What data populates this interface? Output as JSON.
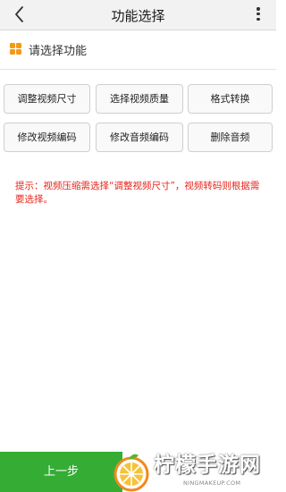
{
  "header": {
    "title": "功能选择",
    "back_icon": "chevron-left-icon",
    "menu_icon": "more-vertical-icon"
  },
  "section": {
    "icon": "grid-icon",
    "icon_color": "#f39a16",
    "title": "请选择功能"
  },
  "functions": [
    {
      "label": "调整视频尺寸"
    },
    {
      "label": "选择视频质量"
    },
    {
      "label": "格式转换"
    },
    {
      "label": "修改视频编码"
    },
    {
      "label": "修改音频编码"
    },
    {
      "label": "删除音频"
    }
  ],
  "hint": "提示：视频压缩需选择“调整视频尺寸”，视频转码则根据需要选择。",
  "hint_color": "#e8231a",
  "footer": {
    "prev_label": "上一步",
    "prev_color": "#35ad35"
  },
  "watermark": {
    "name": "柠檬手游网",
    "url": "NINGMAKEUP.COM"
  }
}
